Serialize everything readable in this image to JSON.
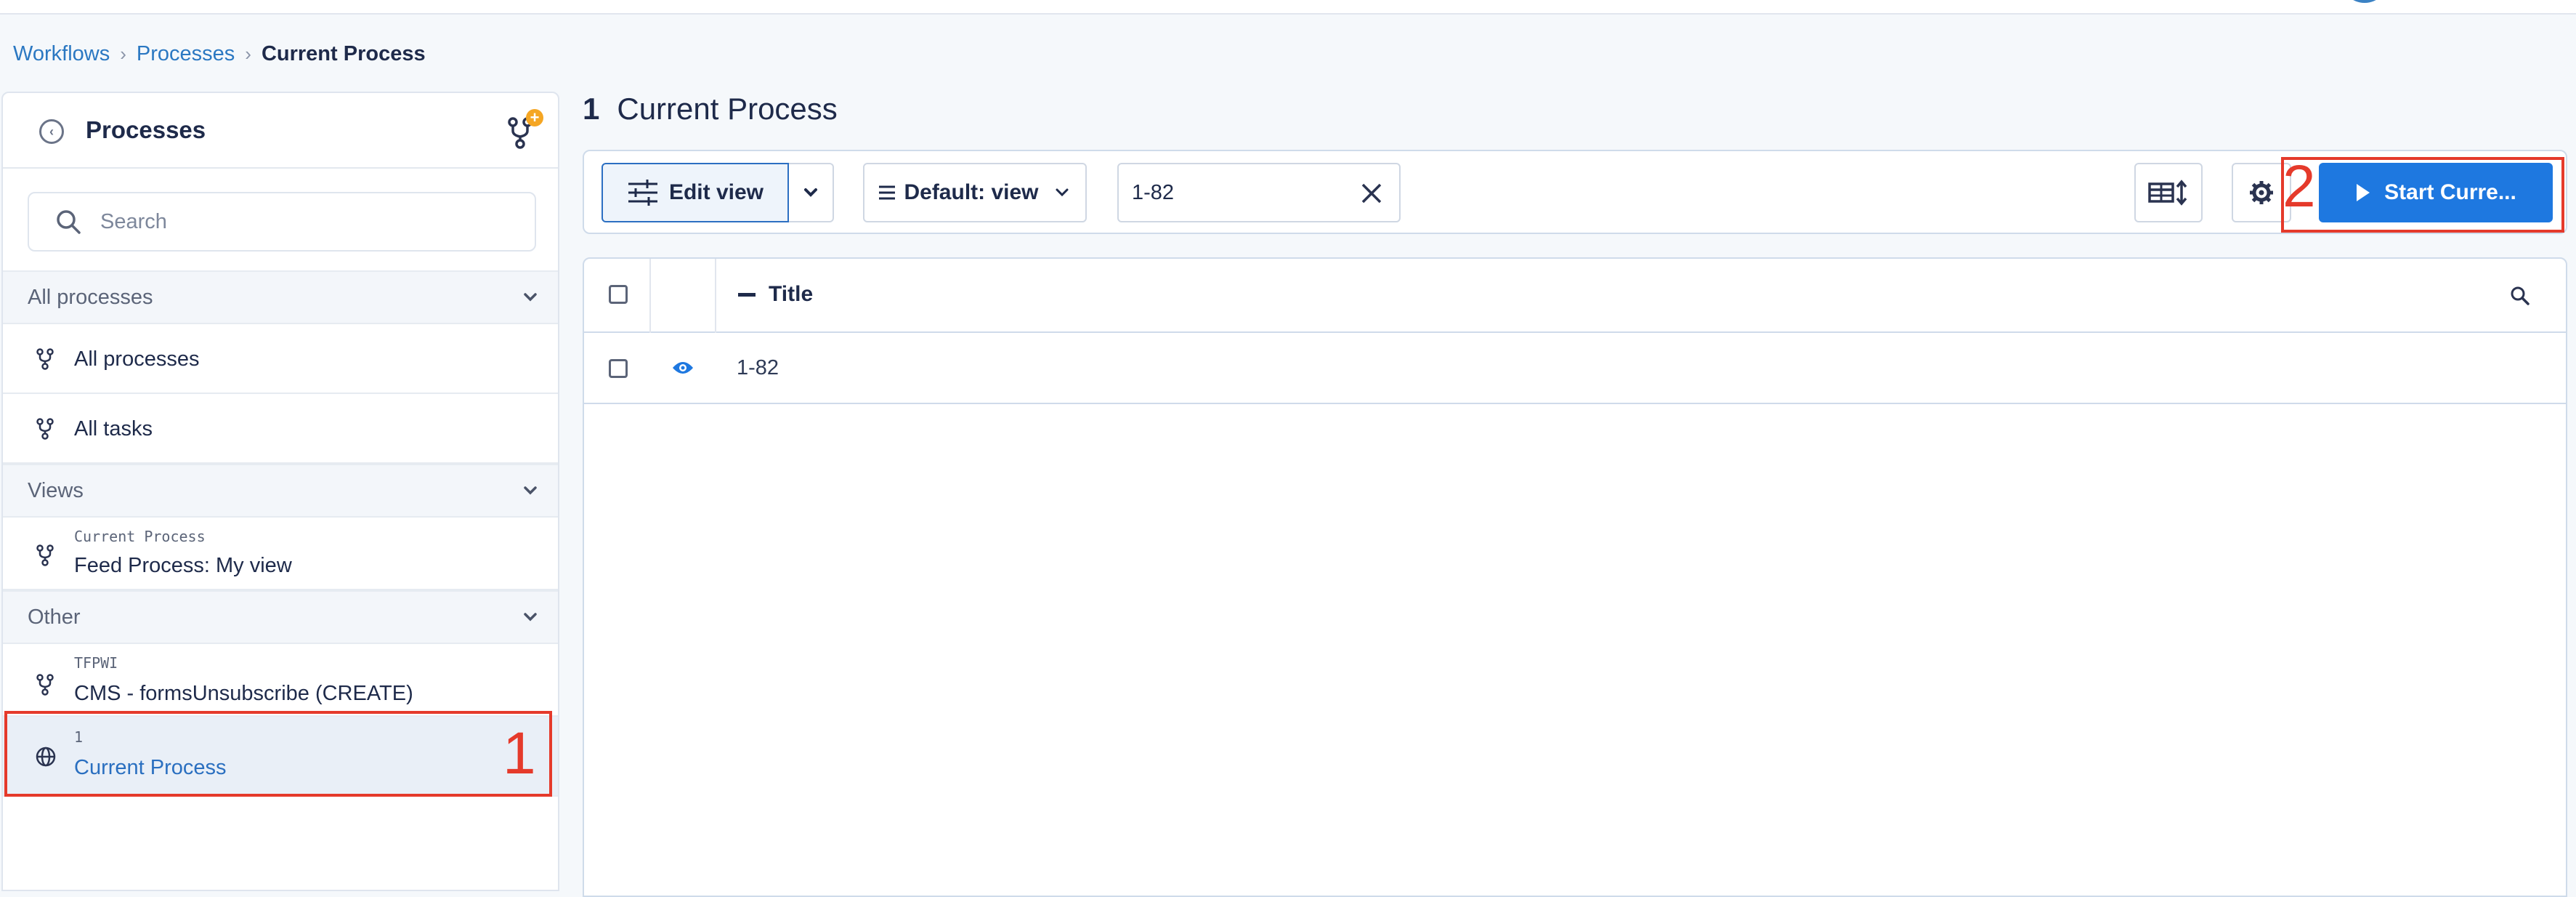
{
  "breadcrumb": {
    "items": [
      "Workflows",
      "Processes"
    ],
    "separator": "›",
    "current": "Current Process"
  },
  "sidebar": {
    "title": "Processes",
    "search_placeholder": "Search",
    "groups": [
      {
        "header": "All processes",
        "items": [
          {
            "label": "All processes"
          },
          {
            "label": "All tasks"
          }
        ]
      },
      {
        "header": "Views",
        "items": [
          {
            "meta": "Current Process",
            "label": "Feed Process: My view"
          }
        ]
      },
      {
        "header": "Other",
        "items": [
          {
            "meta": "TFPWI",
            "label": "CMS - formsUnsubscribe (CREATE)"
          },
          {
            "meta": "1",
            "label": "Current Process",
            "active": true
          }
        ]
      }
    ]
  },
  "main": {
    "count": "1",
    "title": "Current Process",
    "toolbar": {
      "edit_view_label": "Edit view",
      "view_select_label": "Default: view",
      "filter_value": "1-82",
      "start_label": "Start Curre..."
    },
    "table": {
      "columns": [
        "Title"
      ],
      "rows": [
        {
          "title": "1-82"
        }
      ]
    }
  },
  "annotations": {
    "marker_1": "1",
    "marker_2": "2",
    "color": "#e53a2b"
  },
  "colors": {
    "accent": "#1e78e0",
    "link": "#2b78c2",
    "active_item_bg": "#e9eff7"
  }
}
